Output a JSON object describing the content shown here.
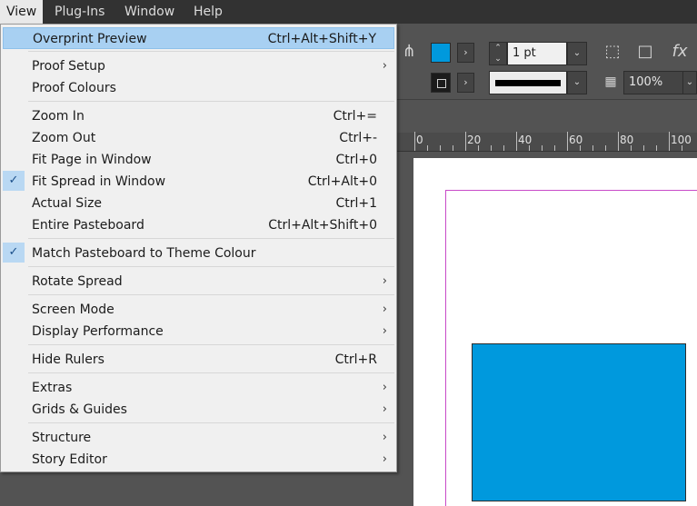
{
  "menubar": {
    "items": [
      {
        "label": "View",
        "active": true
      },
      {
        "label": "Plug-Ins",
        "active": false
      },
      {
        "label": "Window",
        "active": false
      },
      {
        "label": "Help",
        "active": false
      }
    ]
  },
  "control_panel": {
    "fill_color": "#0099dd",
    "stroke_weight": "1 pt",
    "opacity": "100%",
    "icons": [
      "align-icon",
      "frame-fitting-icon",
      "frame-icon",
      "effects-icon",
      "opacity-icon"
    ]
  },
  "ruler": {
    "labels": [
      "0",
      "20",
      "40",
      "60",
      "80",
      "100"
    ]
  },
  "view_menu": {
    "items": [
      {
        "label": "Overprint Preview",
        "shortcut": "Ctrl+Alt+Shift+Y",
        "highlighted": true
      },
      {
        "label": "Proof Setup",
        "submenu": true
      },
      {
        "label": "Proof Colours"
      },
      {
        "label": "Zoom In",
        "shortcut": "Ctrl+="
      },
      {
        "label": "Zoom Out",
        "shortcut": "Ctrl+-"
      },
      {
        "label": "Fit Page in Window",
        "shortcut": "Ctrl+0"
      },
      {
        "label": "Fit Spread in Window",
        "shortcut": "Ctrl+Alt+0",
        "checked": true
      },
      {
        "label": "Actual Size",
        "shortcut": "Ctrl+1"
      },
      {
        "label": "Entire Pasteboard",
        "shortcut": "Ctrl+Alt+Shift+0"
      },
      {
        "label": "Match Pasteboard to Theme Colour",
        "checked": true
      },
      {
        "label": "Rotate Spread",
        "submenu": true
      },
      {
        "label": "Screen Mode",
        "submenu": true
      },
      {
        "label": "Display Performance",
        "submenu": true
      },
      {
        "label": "Hide Rulers",
        "shortcut": "Ctrl+R"
      },
      {
        "label": "Extras",
        "submenu": true
      },
      {
        "label": "Grids & Guides",
        "submenu": true
      },
      {
        "label": "Structure",
        "submenu": true
      },
      {
        "label": "Story Editor",
        "submenu": true
      }
    ],
    "check_glyph": "✓",
    "submenu_glyph": "›"
  },
  "canvas": {
    "rectangle_fill": "#0099dd",
    "guide_color": "#c84ac8"
  }
}
